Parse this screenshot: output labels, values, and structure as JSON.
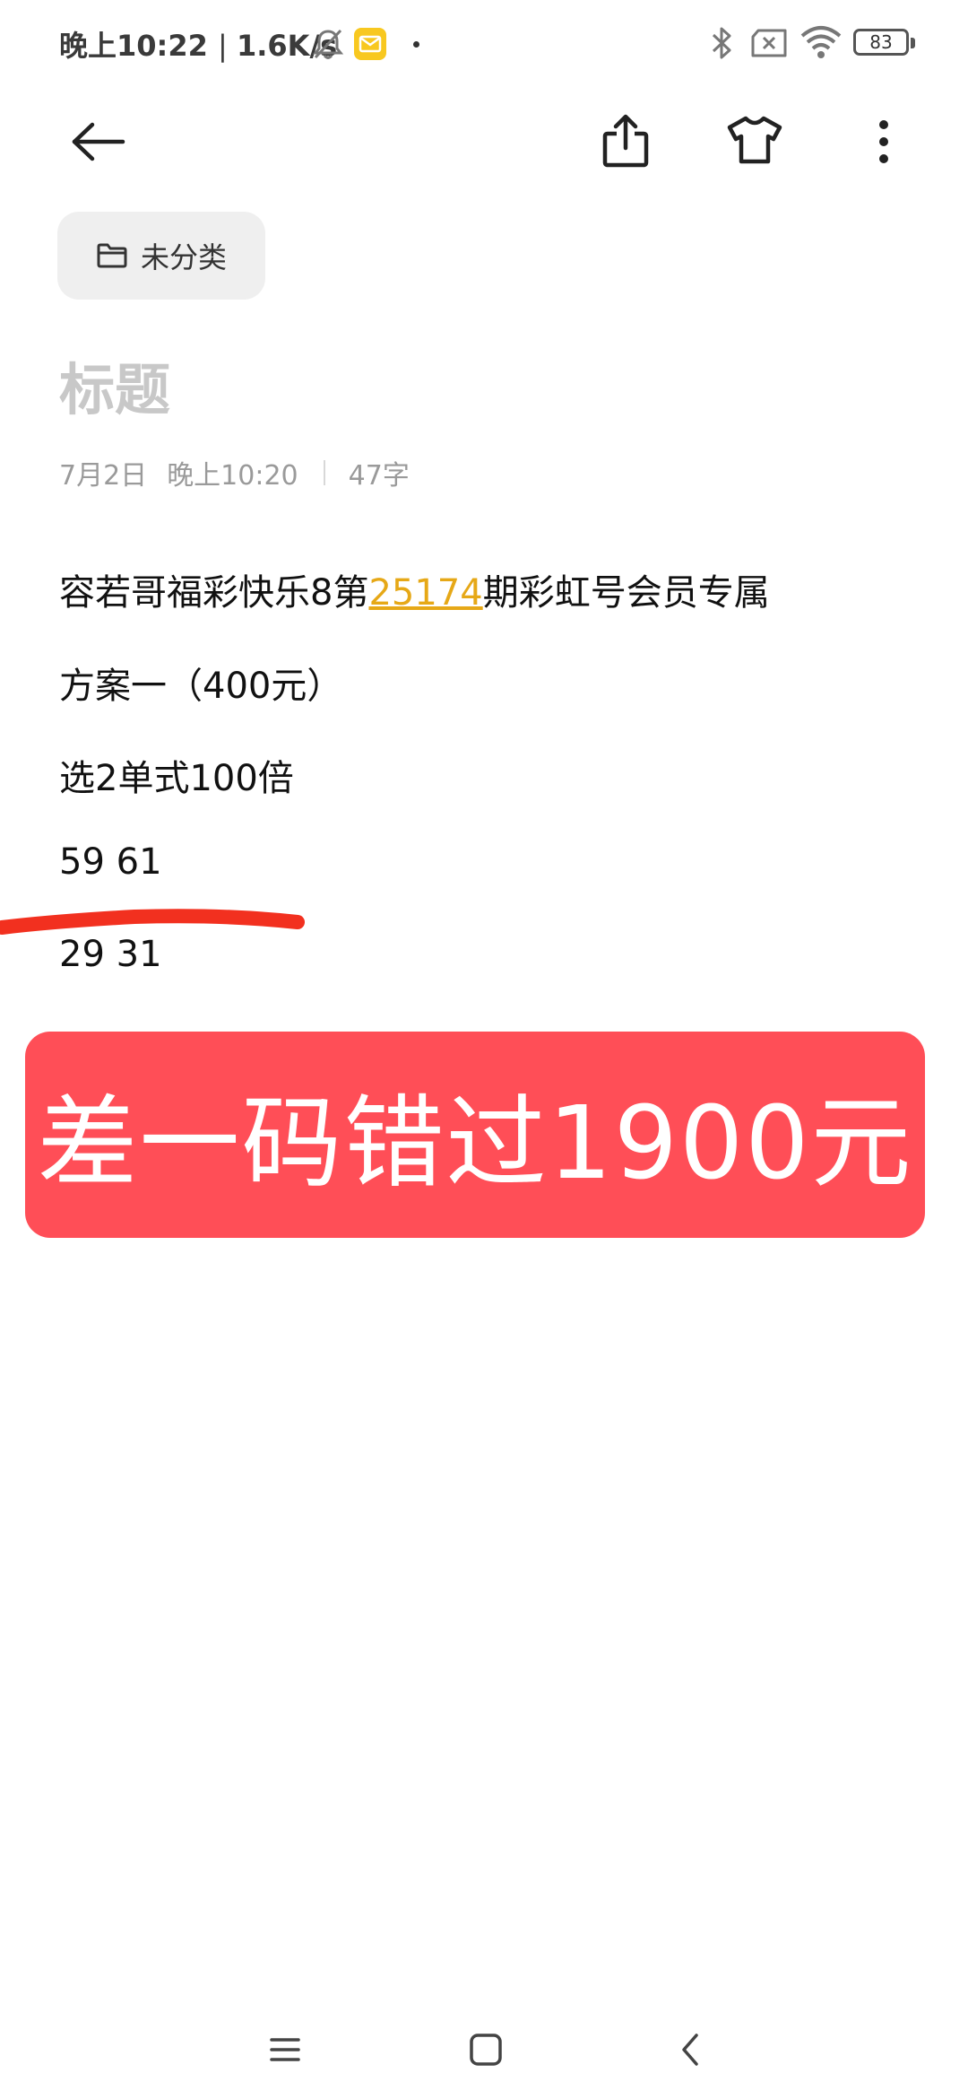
{
  "status_bar": {
    "time": "晚上10:22",
    "speed": "1.6K/s",
    "battery_level": "83",
    "mail_icon_color": "#f8c820"
  },
  "toolbar": {
    "back_icon": "arrow-left-icon",
    "share_icon": "share-icon",
    "theme_icon": "tshirt-icon",
    "more_icon": "more-vertical-icon"
  },
  "category": {
    "label": "未分类",
    "icon": "folder-icon"
  },
  "note": {
    "title_placeholder": "标题",
    "date": "7月2日",
    "time": "晚上10:20",
    "word_count": "47字",
    "line1_prefix": "容若哥福彩快乐8第",
    "line1_issue": "25174",
    "line1_suffix": "期彩虹号会员专属",
    "line2": "方案一（400元）",
    "line3": "选2单式100倍",
    "line4": "59 61",
    "line5": "29 31",
    "issue_color": "#e6a817"
  },
  "banner": {
    "text": "差一码错过1900元",
    "color": "#ff4e57"
  },
  "nav_bar": {
    "menu_icon": "menu-icon",
    "home_icon": "home-square-icon",
    "back_icon": "back-chevron-icon"
  }
}
